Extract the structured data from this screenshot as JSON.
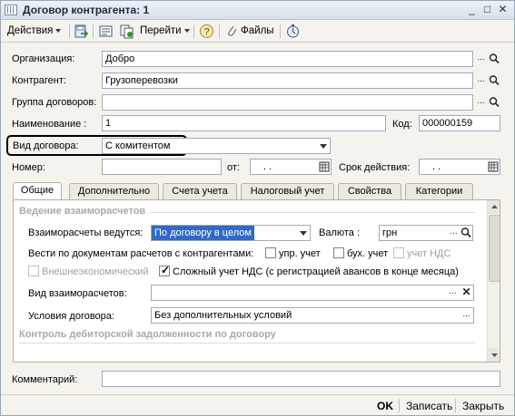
{
  "window": {
    "title": "Договор контрагента: 1"
  },
  "toolbar": {
    "actions_label": "Действия",
    "goto_label": "Перейти",
    "files_label": "Файлы",
    "help_label": "?"
  },
  "form": {
    "organization": {
      "label": "Организация:",
      "value": "Добро"
    },
    "counterparty": {
      "label": "Контрагент:",
      "value": "Грузоперевозки"
    },
    "contract_group": {
      "label": "Группа договоров:",
      "value": ""
    },
    "name": {
      "label": "Наименование :",
      "value": "1"
    },
    "code": {
      "label": "Код:",
      "value": "000000159"
    },
    "contract_type": {
      "label": "Вид договора:",
      "value": "С комитентом"
    },
    "number": {
      "label": "Номер:",
      "value": ""
    },
    "date_from": {
      "label": "от:",
      "value": ". ."
    },
    "valid_until": {
      "label": "Срок действия:",
      "value": ". ."
    }
  },
  "tabs": [
    {
      "label": "Общие"
    },
    {
      "label": "Дополнительно"
    },
    {
      "label": "Счета учета"
    },
    {
      "label": "Налоговый учет"
    },
    {
      "label": "Свойства"
    },
    {
      "label": "Категории"
    }
  ],
  "general": {
    "settlements_section": "Ведение взаиморасчетов",
    "settlements_label": "Взаиморасчеты ведутся:",
    "settlements_value": "По договору в целом",
    "currency_label": "Валюта :",
    "currency_value": "грн",
    "docs_label": "Вести по документам расчетов с контрагентами:",
    "mgmt_accounting": "упр. учет",
    "bookkeeping": "бух. учет",
    "vat_accounting": "учет НДС",
    "foreign_trade": "Внешнеэкономический",
    "complex_vat": "Сложный  учет НДС (с регистрацией авансов в конце месяца)",
    "settlement_type_label": "Вид взаиморасчетов:",
    "settlement_type_value": "",
    "terms_label": "Условия договора:",
    "terms_value": "Без дополнительных условий",
    "receivables_section": "Контроль дебиторской задолженности по договору"
  },
  "comment": {
    "label": "Комментарий:",
    "value": ""
  },
  "footer": {
    "ok": "OK",
    "save": "Записать",
    "close": "Закрыть"
  }
}
